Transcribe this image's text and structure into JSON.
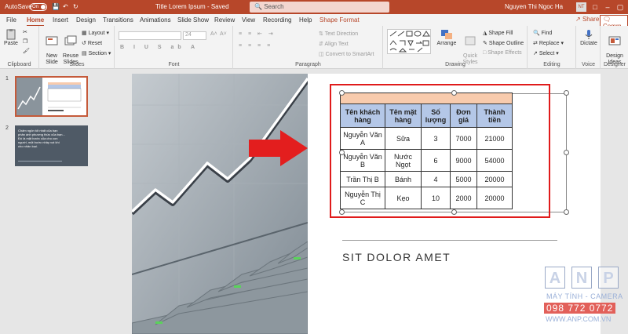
{
  "titlebar": {
    "autosave_label": "AutoSave",
    "autosave_state": "On",
    "doc_title": "Title Lorem Ipsum  -  Saved",
    "search_placeholder": "Search",
    "user_name": "Nguyen Thi Ngoc Ha",
    "user_initials": "NT",
    "accent_color": "#b7472a"
  },
  "tabs": [
    {
      "label": "File"
    },
    {
      "label": "Home"
    },
    {
      "label": "Insert"
    },
    {
      "label": "Design"
    },
    {
      "label": "Transitions"
    },
    {
      "label": "Animations"
    },
    {
      "label": "Slide Show"
    },
    {
      "label": "Review"
    },
    {
      "label": "View"
    },
    {
      "label": "Recording"
    },
    {
      "label": "Help"
    },
    {
      "label": "Shape Format"
    }
  ],
  "active_tab": "Home",
  "share_label": "Share",
  "comments_label": "Comm",
  "ribbon": {
    "clipboard": {
      "paste": "Paste",
      "label": "Clipboard"
    },
    "slides": {
      "new_slide": "New\nSlide",
      "reuse_slides": "Reuse\nSlides",
      "layout": "Layout",
      "reset": "Reset",
      "section": "Section",
      "label": "Slides"
    },
    "font": {
      "size": "24",
      "label": "Font"
    },
    "paragraph": {
      "text_direction": "Text Direction",
      "align_text": "Align Text",
      "convert_smartart": "Convert to SmartArt",
      "label": "Paragraph"
    },
    "drawing": {
      "arrange": "Arrange",
      "quick_styles": "Quick\nStyles",
      "shape_fill": "Shape Fill",
      "shape_outline": "Shape Outline",
      "shape_effects": "Shape Effects",
      "label": "Drawing"
    },
    "editing": {
      "find": "Find",
      "replace": "Replace",
      "select": "Select",
      "label": "Editing"
    },
    "voice": {
      "dictate": "Dictate",
      "label": "Voice"
    },
    "designer": {
      "design_ideas": "Design\nIdeas",
      "label": "Designer"
    }
  },
  "thumbnails": [
    {
      "number": "1"
    },
    {
      "number": "2",
      "text": "Chấm ngôn tốt nhất của bạn phản ánh phương thức của bạn... Đó là mặt bước của cho con người, một bước nhảy vọt khi cho nhân loại."
    }
  ],
  "slide": {
    "heading": "SIT DOLOR AMET",
    "table": {
      "headers": [
        "Tên khách hàng",
        "Tên mặt hàng",
        "Số lượng",
        "Đơn giá",
        "Thành tiền"
      ],
      "rows": [
        [
          "Nguyễn Văn A",
          "Sữa",
          "3",
          "7000",
          "21000"
        ],
        [
          "Nguyễn Văn B",
          "Nước Ngọt",
          "6",
          "9000",
          "54000"
        ],
        [
          "Trần Thị B",
          "Bánh",
          "4",
          "5000",
          "20000"
        ],
        [
          "Nguyễn Thị C",
          "Kẹo",
          "10",
          "2000",
          "20000"
        ]
      ]
    }
  },
  "watermark": {
    "letters": [
      "A",
      "N",
      "P"
    ],
    "line1": "MÁY TÍNH - CAMERA",
    "phone": "098 772 0772",
    "url": "WWW.ANP.COM.VN"
  }
}
